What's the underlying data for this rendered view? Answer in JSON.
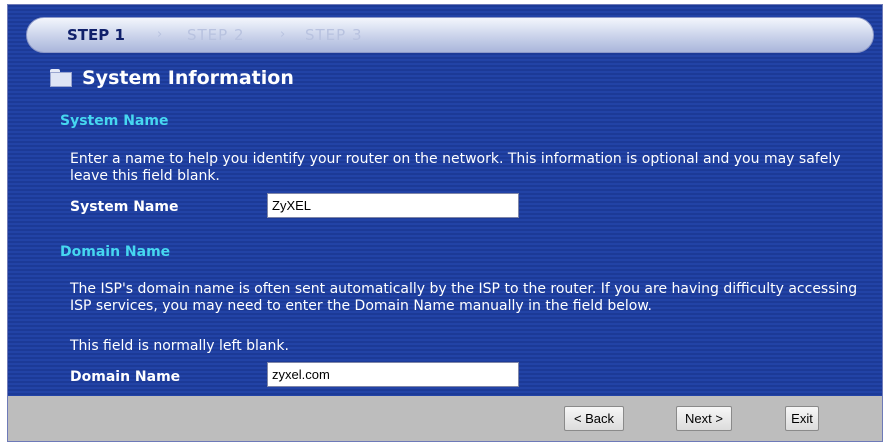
{
  "steps": [
    "STEP 1",
    "STEP 2",
    "STEP 3"
  ],
  "step_separator": "›",
  "page_title": "System Information",
  "system_name_section": {
    "heading": "System Name",
    "description": "Enter a name to help you identify your router on the network. This information is optional and you may safely leave this field blank.",
    "field_label": "System Name",
    "field_value": "ZyXEL"
  },
  "domain_name_section": {
    "heading": "Domain Name",
    "description_line1": "The ISP's domain name is often sent automatically by the ISP to the router. If you are having difficulty accessing ISP services, you may need to enter the Domain Name manually in the field below.",
    "description_line2": "This field is normally left blank.",
    "field_label": "Domain Name",
    "field_value": "zyxel.com"
  },
  "buttons": {
    "back": "< Back",
    "next": "Next >",
    "exit": "Exit"
  }
}
